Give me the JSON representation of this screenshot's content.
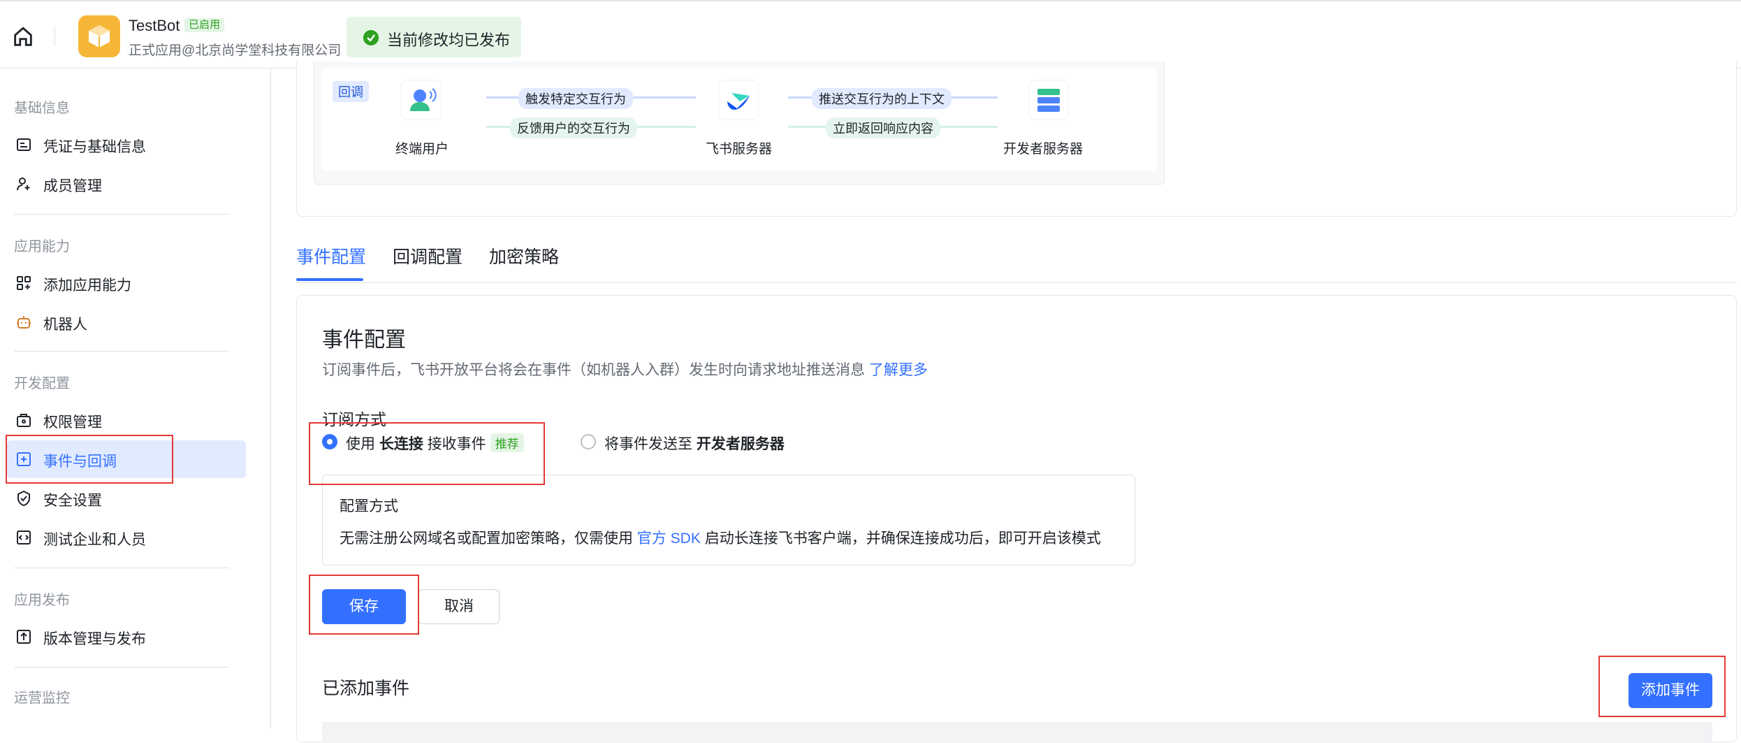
{
  "topbar": {
    "app_name": "TestBot",
    "app_status": "已启用",
    "app_subtitle": "正式应用@北京尚学堂科技有限公司",
    "publish_status": "当前修改均已发布"
  },
  "sidebar": {
    "sections": [
      {
        "title": "基础信息",
        "items": [
          {
            "label": "凭证与基础信息",
            "icon": "id-card-icon"
          },
          {
            "label": "成员管理",
            "icon": "person-add-icon"
          }
        ]
      },
      {
        "title": "应用能力",
        "items": [
          {
            "label": "添加应用能力",
            "icon": "grid-add-icon"
          },
          {
            "label": "机器人",
            "icon": "robot-icon"
          }
        ]
      },
      {
        "title": "开发配置",
        "items": [
          {
            "label": "权限管理",
            "icon": "briefcase-lock-icon"
          },
          {
            "label": "事件与回调",
            "icon": "event-plus-icon",
            "active": true
          },
          {
            "label": "安全设置",
            "icon": "shield-check-icon"
          },
          {
            "label": "测试企业和人员",
            "icon": "code-box-icon"
          }
        ]
      },
      {
        "title": "应用发布",
        "items": [
          {
            "label": "版本管理与发布",
            "icon": "upload-box-icon"
          }
        ]
      },
      {
        "title": "运营监控",
        "items": []
      }
    ]
  },
  "flow": {
    "tag": "回调",
    "nodes": [
      "终端用户",
      "飞书服务器",
      "开发者服务器"
    ],
    "arrows": [
      "触发特定交互行为",
      "反馈用户的交互行为",
      "推送交互行为的上下文",
      "立即返回响应内容"
    ]
  },
  "tabs": [
    "事件配置",
    "回调配置",
    "加密策略"
  ],
  "event_config": {
    "title": "事件配置",
    "desc": "订阅事件后，飞书开放平台将会在事件（如机器人入群）发生时向请求地址推送消息",
    "learn_more": "了解更多",
    "subscribe_label": "订阅方式",
    "option1_prefix": "使用",
    "option1_bold": "长连接",
    "option1_suffix": "接收事件",
    "option1_badge": "推荐",
    "option2_prefix": "将事件发送至",
    "option2_bold": "开发者服务器",
    "config_title": "配置方式",
    "config_text_a": "无需注册公网域名或配置加密策略，仅需使用",
    "config_link": "官方 SDK",
    "config_text_b": "启动长连接飞书客户端，并确保连接成功后，即可开启该模式",
    "save": "保存",
    "cancel": "取消",
    "added_title": "已添加事件",
    "add_button": "添加事件"
  },
  "colors": {
    "accent": "#3370ff",
    "success": "#2ea121",
    "highlight": "#e53935"
  }
}
